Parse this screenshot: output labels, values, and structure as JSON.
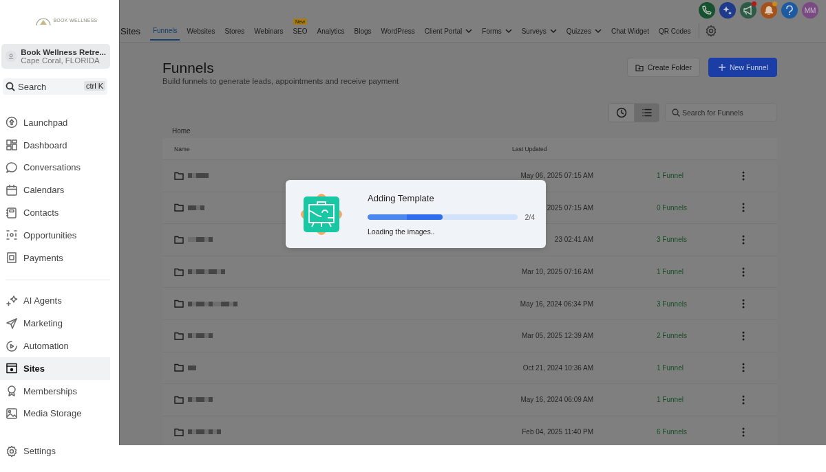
{
  "sidebar": {
    "logo_text": "BOOK WELLNESS",
    "account": {
      "name": "Book Wellness Retre...",
      "location": "Cape Coral, FLORIDA"
    },
    "search": {
      "placeholder": "Search",
      "shortcut": "ctrl K"
    },
    "groups": [
      [
        {
          "label": "Launchpad",
          "selected": false
        },
        {
          "label": "Dashboard",
          "selected": false
        },
        {
          "label": "Conversations",
          "selected": false
        },
        {
          "label": "Calendars",
          "selected": false
        },
        {
          "label": "Contacts",
          "selected": false
        },
        {
          "label": "Opportunities",
          "selected": false
        },
        {
          "label": "Payments",
          "selected": false
        }
      ],
      [
        {
          "label": "AI Agents",
          "selected": false
        },
        {
          "label": "Marketing",
          "selected": false
        },
        {
          "label": "Automation",
          "selected": false
        },
        {
          "label": "Sites",
          "selected": true
        },
        {
          "label": "Memberships",
          "selected": false
        },
        {
          "label": "Media Storage",
          "selected": false
        }
      ]
    ],
    "settings": "Settings"
  },
  "header": {
    "avatar": "MM",
    "notification_dots": [
      false,
      false,
      true,
      true,
      false,
      false
    ]
  },
  "section_title": "Sites",
  "tabs": [
    {
      "label": "Funnels",
      "selected": true,
      "dropdown": false
    },
    {
      "label": "Websites",
      "selected": false,
      "dropdown": false
    },
    {
      "label": "Stores",
      "selected": false,
      "dropdown": false
    },
    {
      "label": "Webinars",
      "selected": false,
      "dropdown": false
    },
    {
      "label": "SEO",
      "selected": false,
      "dropdown": false,
      "badge": "New"
    },
    {
      "label": "Analytics",
      "selected": false,
      "dropdown": false
    },
    {
      "label": "Blogs",
      "selected": false,
      "dropdown": false
    },
    {
      "label": "WordPress",
      "selected": false,
      "dropdown": false
    },
    {
      "label": "Client Portal",
      "selected": false,
      "dropdown": true
    },
    {
      "label": "Forms",
      "selected": false,
      "dropdown": true
    },
    {
      "label": "Surveys",
      "selected": false,
      "dropdown": true
    },
    {
      "label": "Quizzes",
      "selected": false,
      "dropdown": true
    },
    {
      "label": "Chat Widget",
      "selected": false,
      "dropdown": false
    },
    {
      "label": "QR Codes",
      "selected": false,
      "dropdown": false
    }
  ],
  "page": {
    "title": "Funnels",
    "subtitle": "Build funnels to generate leads, appointments and receive payment",
    "buttons": [
      {
        "label": "Create Folder",
        "kind": "secondary"
      },
      {
        "label": "New Funnel",
        "kind": "primary"
      }
    ],
    "view_toggle": [
      {
        "selected": false
      },
      {
        "selected": true
      }
    ],
    "search": {
      "placeholder": "Search for Funnels"
    },
    "breadcrumb": "Home"
  },
  "table": {
    "columns": [
      "Name",
      "Last Updated"
    ],
    "rows": [
      {
        "updated": "May 06, 2025 07:15 AM",
        "count": "1 Funnel"
      },
      {
        "updated": "2025 07:15 AM",
        "count": "0 Funnels"
      },
      {
        "updated": "23 02:41 AM",
        "count": "3 Funnels"
      },
      {
        "updated": "Mar 10, 2025 07:16 AM",
        "count": "1 Funnel"
      },
      {
        "updated": "May 16, 2024 06:34 PM",
        "count": "3 Funnels"
      },
      {
        "updated": "Mar 05, 2025 12:39 AM",
        "count": "2 Funnels"
      },
      {
        "updated": "Oct 21, 2024 10:36 AM",
        "count": "1 Funnel"
      },
      {
        "updated": "May 16, 2024 06:09 AM",
        "count": "1 Funnel"
      },
      {
        "updated": "Feb 04, 2025 11:40 PM",
        "count": "6 Funnels"
      }
    ]
  },
  "modal": {
    "title": "Adding Template",
    "progress": {
      "level": 0.5,
      "reading": "2/4"
    },
    "message": "Loading the images.."
  }
}
